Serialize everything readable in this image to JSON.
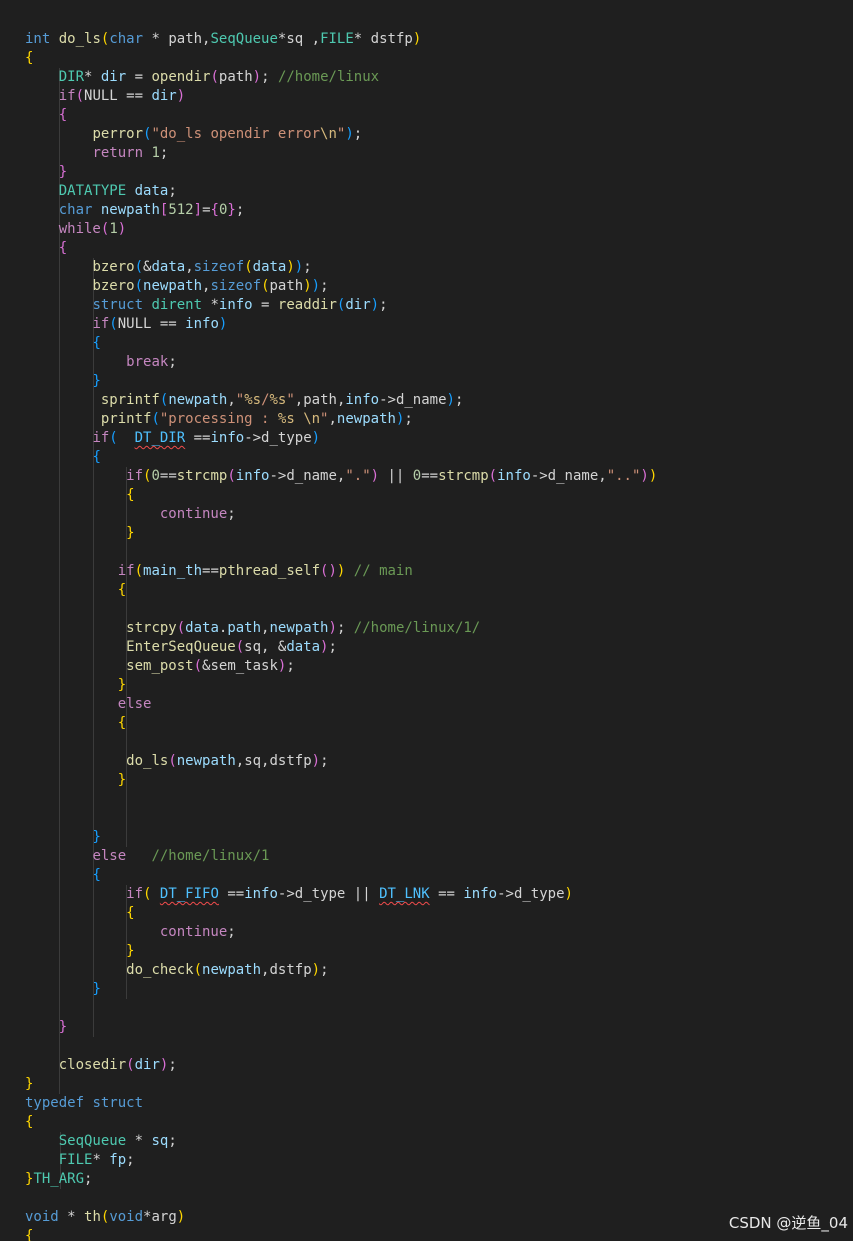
{
  "editor": {
    "language": "c",
    "theme": "dark",
    "lines": [
      [
        [
          "kw",
          "int"
        ],
        [
          "pl",
          " "
        ],
        [
          "fn",
          "do_ls"
        ],
        [
          "p1",
          "("
        ],
        [
          "kw",
          "char"
        ],
        [
          "pl",
          " * path,"
        ],
        [
          "ty",
          "SeqQueue"
        ],
        [
          "pl",
          "*sq ,"
        ],
        [
          "ty",
          "FILE"
        ],
        [
          "pl",
          "* dstfp"
        ],
        [
          "p1",
          ")"
        ]
      ],
      [
        [
          "p1",
          "{"
        ]
      ],
      [
        [
          "pl",
          "    "
        ],
        [
          "ty",
          "DIR"
        ],
        [
          "pl",
          "* "
        ],
        [
          "var",
          "dir"
        ],
        [
          "pl",
          " = "
        ],
        [
          "fn",
          "opendir"
        ],
        [
          "p2",
          "("
        ],
        [
          "pl",
          "path"
        ],
        [
          "p2",
          ")"
        ],
        [
          "pl",
          "; "
        ],
        [
          "com",
          "//home/linux"
        ]
      ],
      [
        [
          "pl",
          "    "
        ],
        [
          "ctl",
          "if"
        ],
        [
          "p2",
          "("
        ],
        [
          "pl",
          "NULL == "
        ],
        [
          "var",
          "dir"
        ],
        [
          "p2",
          ")"
        ]
      ],
      [
        [
          "pl",
          "    "
        ],
        [
          "p2",
          "{"
        ]
      ],
      [
        [
          "pl",
          "        "
        ],
        [
          "fn",
          "perror"
        ],
        [
          "p3",
          "("
        ],
        [
          "str",
          "\"do_ls opendir error"
        ],
        [
          "esc",
          "\\n"
        ],
        [
          "str",
          "\""
        ],
        [
          "p3",
          ")"
        ],
        [
          "pl",
          ";"
        ]
      ],
      [
        [
          "pl",
          "        "
        ],
        [
          "ctl",
          "return"
        ],
        [
          "pl",
          " "
        ],
        [
          "num",
          "1"
        ],
        [
          "pl",
          ";"
        ]
      ],
      [
        [
          "pl",
          "    "
        ],
        [
          "p2",
          "}"
        ]
      ],
      [
        [
          "pl",
          "    "
        ],
        [
          "ty",
          "DATATYPE"
        ],
        [
          "pl",
          " "
        ],
        [
          "var",
          "data"
        ],
        [
          "pl",
          ";"
        ]
      ],
      [
        [
          "pl",
          "    "
        ],
        [
          "kw",
          "char"
        ],
        [
          "pl",
          " "
        ],
        [
          "var",
          "newpath"
        ],
        [
          "p2",
          "["
        ],
        [
          "num",
          "512"
        ],
        [
          "p2",
          "]"
        ],
        [
          "pl",
          "="
        ],
        [
          "p2",
          "{"
        ],
        [
          "num",
          "0"
        ],
        [
          "p2",
          "}"
        ],
        [
          "pl",
          ";"
        ]
      ],
      [
        [
          "pl",
          "    "
        ],
        [
          "ctl",
          "while"
        ],
        [
          "p2",
          "("
        ],
        [
          "num",
          "1"
        ],
        [
          "p2",
          ")"
        ]
      ],
      [
        [
          "pl",
          "    "
        ],
        [
          "p2",
          "{"
        ]
      ],
      [
        [
          "pl",
          "        "
        ],
        [
          "fn",
          "bzero"
        ],
        [
          "p3",
          "("
        ],
        [
          "pl",
          "&"
        ],
        [
          "var",
          "data"
        ],
        [
          "pl",
          ","
        ],
        [
          "kw",
          "sizeof"
        ],
        [
          "p1",
          "("
        ],
        [
          "var",
          "data"
        ],
        [
          "p1",
          ")"
        ],
        [
          "p3",
          ")"
        ],
        [
          "pl",
          ";"
        ]
      ],
      [
        [
          "pl",
          "        "
        ],
        [
          "fn",
          "bzero"
        ],
        [
          "p3",
          "("
        ],
        [
          "var",
          "newpath"
        ],
        [
          "pl",
          ","
        ],
        [
          "kw",
          "sizeof"
        ],
        [
          "p1",
          "("
        ],
        [
          "pl",
          "path"
        ],
        [
          "p1",
          ")"
        ],
        [
          "p3",
          ")"
        ],
        [
          "pl",
          ";"
        ]
      ],
      [
        [
          "pl",
          "        "
        ],
        [
          "kw",
          "struct"
        ],
        [
          "pl",
          " "
        ],
        [
          "ty",
          "dirent"
        ],
        [
          "pl",
          " *"
        ],
        [
          "var",
          "info"
        ],
        [
          "pl",
          " = "
        ],
        [
          "fn",
          "readdir"
        ],
        [
          "p3",
          "("
        ],
        [
          "var",
          "dir"
        ],
        [
          "p3",
          ")"
        ],
        [
          "pl",
          ";"
        ]
      ],
      [
        [
          "pl",
          "        "
        ],
        [
          "ctl",
          "if"
        ],
        [
          "p3",
          "("
        ],
        [
          "pl",
          "NULL == "
        ],
        [
          "var",
          "info"
        ],
        [
          "p3",
          ")"
        ]
      ],
      [
        [
          "pl",
          "        "
        ],
        [
          "p3",
          "{"
        ]
      ],
      [
        [
          "pl",
          "            "
        ],
        [
          "ctl",
          "break"
        ],
        [
          "pl",
          ";"
        ]
      ],
      [
        [
          "pl",
          "        "
        ],
        [
          "p3",
          "}"
        ]
      ],
      [
        [
          "pl",
          "         "
        ],
        [
          "fn",
          "sprintf"
        ],
        [
          "p3",
          "("
        ],
        [
          "var",
          "newpath"
        ],
        [
          "pl",
          ","
        ],
        [
          "str",
          "\""
        ],
        [
          "esc",
          "%s"
        ],
        [
          "str",
          "/"
        ],
        [
          "esc",
          "%s"
        ],
        [
          "str",
          "\""
        ],
        [
          "pl",
          ",path,"
        ],
        [
          "var",
          "info"
        ],
        [
          "pl",
          "->d_name"
        ],
        [
          "p3",
          ")"
        ],
        [
          "pl",
          ";"
        ]
      ],
      [
        [
          "pl",
          "         "
        ],
        [
          "fn",
          "printf"
        ],
        [
          "p3",
          "("
        ],
        [
          "str",
          "\"processing : "
        ],
        [
          "esc",
          "%s"
        ],
        [
          "str",
          " "
        ],
        [
          "esc",
          "\\n"
        ],
        [
          "str",
          "\""
        ],
        [
          "pl",
          ","
        ],
        [
          "var",
          "newpath"
        ],
        [
          "p3",
          ")"
        ],
        [
          "pl",
          ";"
        ]
      ],
      [
        [
          "pl",
          "        "
        ],
        [
          "ctl",
          "if"
        ],
        [
          "p3",
          "("
        ],
        [
          "pl",
          "  "
        ],
        [
          "sq",
          "DT_DIR"
        ],
        [
          "pl",
          " =="
        ],
        [
          "var",
          "info"
        ],
        [
          "pl",
          "->d_type"
        ],
        [
          "p3",
          ")"
        ]
      ],
      [
        [
          "pl",
          "        "
        ],
        [
          "p3",
          "{"
        ]
      ],
      [
        [
          "pl",
          "            "
        ],
        [
          "ctl",
          "if"
        ],
        [
          "p1",
          "("
        ],
        [
          "num",
          "0"
        ],
        [
          "pl",
          "=="
        ],
        [
          "fn",
          "strcmp"
        ],
        [
          "p2",
          "("
        ],
        [
          "var",
          "info"
        ],
        [
          "pl",
          "->d_name,"
        ],
        [
          "str",
          "\".\""
        ],
        [
          "p2",
          ")"
        ],
        [
          "pl",
          " || "
        ],
        [
          "num",
          "0"
        ],
        [
          "pl",
          "=="
        ],
        [
          "fn",
          "strcmp"
        ],
        [
          "p2",
          "("
        ],
        [
          "var",
          "info"
        ],
        [
          "pl",
          "->d_name,"
        ],
        [
          "str",
          "\"..\""
        ],
        [
          "p2",
          ")"
        ],
        [
          "p1",
          ")"
        ]
      ],
      [
        [
          "pl",
          "            "
        ],
        [
          "p1",
          "{"
        ]
      ],
      [
        [
          "pl",
          "                "
        ],
        [
          "ctl",
          "continue"
        ],
        [
          "pl",
          ";"
        ]
      ],
      [
        [
          "pl",
          "            "
        ],
        [
          "p1",
          "}"
        ]
      ],
      [
        [
          "pl",
          ""
        ]
      ],
      [
        [
          "pl",
          "           "
        ],
        [
          "ctl",
          "if"
        ],
        [
          "p1",
          "("
        ],
        [
          "var",
          "main_th"
        ],
        [
          "pl",
          "=="
        ],
        [
          "fn",
          "pthread_self"
        ],
        [
          "p2",
          "()"
        ],
        [
          "p1",
          ")"
        ],
        [
          "pl",
          " "
        ],
        [
          "com",
          "// main"
        ]
      ],
      [
        [
          "pl",
          "           "
        ],
        [
          "p1",
          "{"
        ]
      ],
      [
        [
          "pl",
          ""
        ]
      ],
      [
        [
          "pl",
          "            "
        ],
        [
          "fn",
          "strcpy"
        ],
        [
          "p2",
          "("
        ],
        [
          "var",
          "data"
        ],
        [
          "pl",
          "."
        ],
        [
          "var",
          "path"
        ],
        [
          "pl",
          ","
        ],
        [
          "var",
          "newpath"
        ],
        [
          "p2",
          ")"
        ],
        [
          "pl",
          "; "
        ],
        [
          "com",
          "//home/linux/1/"
        ]
      ],
      [
        [
          "pl",
          "            "
        ],
        [
          "fn",
          "EnterSeqQueue"
        ],
        [
          "p2",
          "("
        ],
        [
          "pl",
          "sq, &"
        ],
        [
          "var",
          "data"
        ],
        [
          "p2",
          ")"
        ],
        [
          "pl",
          ";"
        ]
      ],
      [
        [
          "pl",
          "            "
        ],
        [
          "fn",
          "sem_post"
        ],
        [
          "p2",
          "("
        ],
        [
          "pl",
          "&sem_task"
        ],
        [
          "p2",
          ")"
        ],
        [
          "pl",
          ";"
        ]
      ],
      [
        [
          "pl",
          "           "
        ],
        [
          "p1",
          "}"
        ]
      ],
      [
        [
          "pl",
          "           "
        ],
        [
          "ctl",
          "else"
        ]
      ],
      [
        [
          "pl",
          "           "
        ],
        [
          "p1",
          "{"
        ]
      ],
      [
        [
          "pl",
          ""
        ]
      ],
      [
        [
          "pl",
          "            "
        ],
        [
          "fn",
          "do_ls"
        ],
        [
          "p2",
          "("
        ],
        [
          "var",
          "newpath"
        ],
        [
          "pl",
          ",sq,dstfp"
        ],
        [
          "p2",
          ")"
        ],
        [
          "pl",
          ";"
        ]
      ],
      [
        [
          "pl",
          "           "
        ],
        [
          "p1",
          "}"
        ]
      ],
      [
        [
          "pl",
          ""
        ]
      ],
      [
        [
          "pl",
          ""
        ]
      ],
      [
        [
          "pl",
          "        "
        ],
        [
          "p3",
          "}"
        ]
      ],
      [
        [
          "pl",
          "        "
        ],
        [
          "ctl",
          "else"
        ],
        [
          "pl",
          "   "
        ],
        [
          "com",
          "//home/linux/1"
        ]
      ],
      [
        [
          "pl",
          "        "
        ],
        [
          "p3",
          "{"
        ]
      ],
      [
        [
          "pl",
          "            "
        ],
        [
          "ctl",
          "if"
        ],
        [
          "p1",
          "("
        ],
        [
          "pl",
          " "
        ],
        [
          "sq",
          "DT_FIFO"
        ],
        [
          "pl",
          " =="
        ],
        [
          "var",
          "info"
        ],
        [
          "pl",
          "->d_type || "
        ],
        [
          "sq",
          "DT_LNK"
        ],
        [
          "pl",
          " == "
        ],
        [
          "var",
          "info"
        ],
        [
          "pl",
          "->d_type"
        ],
        [
          "p1",
          ")"
        ]
      ],
      [
        [
          "pl",
          "            "
        ],
        [
          "p1",
          "{"
        ]
      ],
      [
        [
          "pl",
          "                "
        ],
        [
          "ctl",
          "continue"
        ],
        [
          "pl",
          ";"
        ]
      ],
      [
        [
          "pl",
          "            "
        ],
        [
          "p1",
          "}"
        ]
      ],
      [
        [
          "pl",
          "            "
        ],
        [
          "fn",
          "do_check"
        ],
        [
          "p1",
          "("
        ],
        [
          "var",
          "newpath"
        ],
        [
          "pl",
          ",dstfp"
        ],
        [
          "p1",
          ")"
        ],
        [
          "pl",
          ";"
        ]
      ],
      [
        [
          "pl",
          "        "
        ],
        [
          "p3",
          "}"
        ]
      ],
      [
        [
          "pl",
          ""
        ]
      ],
      [
        [
          "pl",
          "    "
        ],
        [
          "p2",
          "}"
        ]
      ],
      [
        [
          "pl",
          ""
        ]
      ],
      [
        [
          "pl",
          "    "
        ],
        [
          "fn",
          "closedir"
        ],
        [
          "p2",
          "("
        ],
        [
          "var",
          "dir"
        ],
        [
          "p2",
          ")"
        ],
        [
          "pl",
          ";"
        ]
      ],
      [
        [
          "p1",
          "}"
        ]
      ],
      [
        [
          "kw",
          "typedef"
        ],
        [
          "pl",
          " "
        ],
        [
          "kw",
          "struct"
        ]
      ],
      [
        [
          "p1",
          "{"
        ]
      ],
      [
        [
          "pl",
          "    "
        ],
        [
          "ty",
          "SeqQueue"
        ],
        [
          "pl",
          " * "
        ],
        [
          "var",
          "sq"
        ],
        [
          "pl",
          ";"
        ]
      ],
      [
        [
          "pl",
          "    "
        ],
        [
          "ty",
          "FILE"
        ],
        [
          "pl",
          "* "
        ],
        [
          "var",
          "fp"
        ],
        [
          "pl",
          ";"
        ]
      ],
      [
        [
          "p1",
          "}"
        ],
        [
          "ty",
          "TH_ARG"
        ],
        [
          "pl",
          ";"
        ]
      ],
      [
        [
          "pl",
          ""
        ]
      ],
      [
        [
          "kw",
          "void"
        ],
        [
          "pl",
          " * "
        ],
        [
          "fn",
          "th"
        ],
        [
          "p1",
          "("
        ],
        [
          "kw",
          "void"
        ],
        [
          "pl",
          "*arg"
        ],
        [
          "p1",
          ")"
        ]
      ],
      [
        [
          "p1",
          "{"
        ]
      ]
    ]
  },
  "watermark": {
    "text": "CSDN @逆鱼_04"
  }
}
